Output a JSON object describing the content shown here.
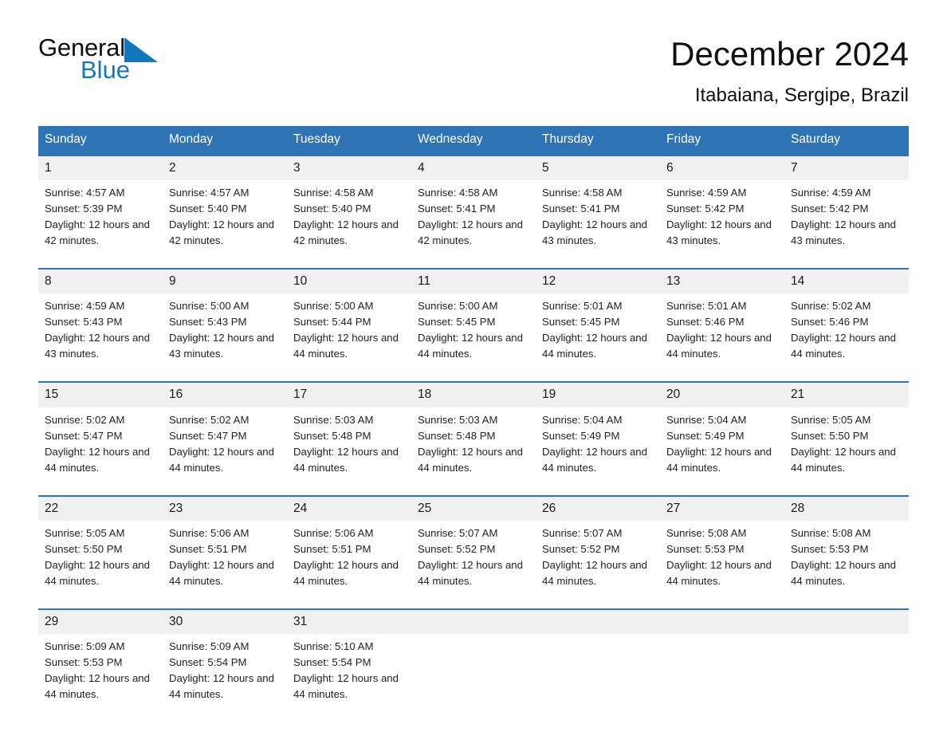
{
  "brand": {
    "name_part1": "General",
    "name_part2": "Blue",
    "triangle_color": "#1278bd"
  },
  "header": {
    "title": "December 2024",
    "subtitle": "Itabaiana, Sergipe, Brazil"
  },
  "colors": {
    "header_blue": "#2e74b5",
    "daynum_band": "#f0f0f0",
    "text": "#222222"
  },
  "weekdays": [
    "Sunday",
    "Monday",
    "Tuesday",
    "Wednesday",
    "Thursday",
    "Friday",
    "Saturday"
  ],
  "weeks": [
    [
      {
        "day": "1",
        "sunrise": "Sunrise: 4:57 AM",
        "sunset": "Sunset: 5:39 PM",
        "daylight": "Daylight: 12 hours and 42 minutes."
      },
      {
        "day": "2",
        "sunrise": "Sunrise: 4:57 AM",
        "sunset": "Sunset: 5:40 PM",
        "daylight": "Daylight: 12 hours and 42 minutes."
      },
      {
        "day": "3",
        "sunrise": "Sunrise: 4:58 AM",
        "sunset": "Sunset: 5:40 PM",
        "daylight": "Daylight: 12 hours and 42 minutes."
      },
      {
        "day": "4",
        "sunrise": "Sunrise: 4:58 AM",
        "sunset": "Sunset: 5:41 PM",
        "daylight": "Daylight: 12 hours and 42 minutes."
      },
      {
        "day": "5",
        "sunrise": "Sunrise: 4:58 AM",
        "sunset": "Sunset: 5:41 PM",
        "daylight": "Daylight: 12 hours and 43 minutes."
      },
      {
        "day": "6",
        "sunrise": "Sunrise: 4:59 AM",
        "sunset": "Sunset: 5:42 PM",
        "daylight": "Daylight: 12 hours and 43 minutes."
      },
      {
        "day": "7",
        "sunrise": "Sunrise: 4:59 AM",
        "sunset": "Sunset: 5:42 PM",
        "daylight": "Daylight: 12 hours and 43 minutes."
      }
    ],
    [
      {
        "day": "8",
        "sunrise": "Sunrise: 4:59 AM",
        "sunset": "Sunset: 5:43 PM",
        "daylight": "Daylight: 12 hours and 43 minutes."
      },
      {
        "day": "9",
        "sunrise": "Sunrise: 5:00 AM",
        "sunset": "Sunset: 5:43 PM",
        "daylight": "Daylight: 12 hours and 43 minutes."
      },
      {
        "day": "10",
        "sunrise": "Sunrise: 5:00 AM",
        "sunset": "Sunset: 5:44 PM",
        "daylight": "Daylight: 12 hours and 44 minutes."
      },
      {
        "day": "11",
        "sunrise": "Sunrise: 5:00 AM",
        "sunset": "Sunset: 5:45 PM",
        "daylight": "Daylight: 12 hours and 44 minutes."
      },
      {
        "day": "12",
        "sunrise": "Sunrise: 5:01 AM",
        "sunset": "Sunset: 5:45 PM",
        "daylight": "Daylight: 12 hours and 44 minutes."
      },
      {
        "day": "13",
        "sunrise": "Sunrise: 5:01 AM",
        "sunset": "Sunset: 5:46 PM",
        "daylight": "Daylight: 12 hours and 44 minutes."
      },
      {
        "day": "14",
        "sunrise": "Sunrise: 5:02 AM",
        "sunset": "Sunset: 5:46 PM",
        "daylight": "Daylight: 12 hours and 44 minutes."
      }
    ],
    [
      {
        "day": "15",
        "sunrise": "Sunrise: 5:02 AM",
        "sunset": "Sunset: 5:47 PM",
        "daylight": "Daylight: 12 hours and 44 minutes."
      },
      {
        "day": "16",
        "sunrise": "Sunrise: 5:02 AM",
        "sunset": "Sunset: 5:47 PM",
        "daylight": "Daylight: 12 hours and 44 minutes."
      },
      {
        "day": "17",
        "sunrise": "Sunrise: 5:03 AM",
        "sunset": "Sunset: 5:48 PM",
        "daylight": "Daylight: 12 hours and 44 minutes."
      },
      {
        "day": "18",
        "sunrise": "Sunrise: 5:03 AM",
        "sunset": "Sunset: 5:48 PM",
        "daylight": "Daylight: 12 hours and 44 minutes."
      },
      {
        "day": "19",
        "sunrise": "Sunrise: 5:04 AM",
        "sunset": "Sunset: 5:49 PM",
        "daylight": "Daylight: 12 hours and 44 minutes."
      },
      {
        "day": "20",
        "sunrise": "Sunrise: 5:04 AM",
        "sunset": "Sunset: 5:49 PM",
        "daylight": "Daylight: 12 hours and 44 minutes."
      },
      {
        "day": "21",
        "sunrise": "Sunrise: 5:05 AM",
        "sunset": "Sunset: 5:50 PM",
        "daylight": "Daylight: 12 hours and 44 minutes."
      }
    ],
    [
      {
        "day": "22",
        "sunrise": "Sunrise: 5:05 AM",
        "sunset": "Sunset: 5:50 PM",
        "daylight": "Daylight: 12 hours and 44 minutes."
      },
      {
        "day": "23",
        "sunrise": "Sunrise: 5:06 AM",
        "sunset": "Sunset: 5:51 PM",
        "daylight": "Daylight: 12 hours and 44 minutes."
      },
      {
        "day": "24",
        "sunrise": "Sunrise: 5:06 AM",
        "sunset": "Sunset: 5:51 PM",
        "daylight": "Daylight: 12 hours and 44 minutes."
      },
      {
        "day": "25",
        "sunrise": "Sunrise: 5:07 AM",
        "sunset": "Sunset: 5:52 PM",
        "daylight": "Daylight: 12 hours and 44 minutes."
      },
      {
        "day": "26",
        "sunrise": "Sunrise: 5:07 AM",
        "sunset": "Sunset: 5:52 PM",
        "daylight": "Daylight: 12 hours and 44 minutes."
      },
      {
        "day": "27",
        "sunrise": "Sunrise: 5:08 AM",
        "sunset": "Sunset: 5:53 PM",
        "daylight": "Daylight: 12 hours and 44 minutes."
      },
      {
        "day": "28",
        "sunrise": "Sunrise: 5:08 AM",
        "sunset": "Sunset: 5:53 PM",
        "daylight": "Daylight: 12 hours and 44 minutes."
      }
    ],
    [
      {
        "day": "29",
        "sunrise": "Sunrise: 5:09 AM",
        "sunset": "Sunset: 5:53 PM",
        "daylight": "Daylight: 12 hours and 44 minutes."
      },
      {
        "day": "30",
        "sunrise": "Sunrise: 5:09 AM",
        "sunset": "Sunset: 5:54 PM",
        "daylight": "Daylight: 12 hours and 44 minutes."
      },
      {
        "day": "31",
        "sunrise": "Sunrise: 5:10 AM",
        "sunset": "Sunset: 5:54 PM",
        "daylight": "Daylight: 12 hours and 44 minutes."
      },
      {
        "day": "",
        "sunrise": "",
        "sunset": "",
        "daylight": ""
      },
      {
        "day": "",
        "sunrise": "",
        "sunset": "",
        "daylight": ""
      },
      {
        "day": "",
        "sunrise": "",
        "sunset": "",
        "daylight": ""
      },
      {
        "day": "",
        "sunrise": "",
        "sunset": "",
        "daylight": ""
      }
    ]
  ]
}
